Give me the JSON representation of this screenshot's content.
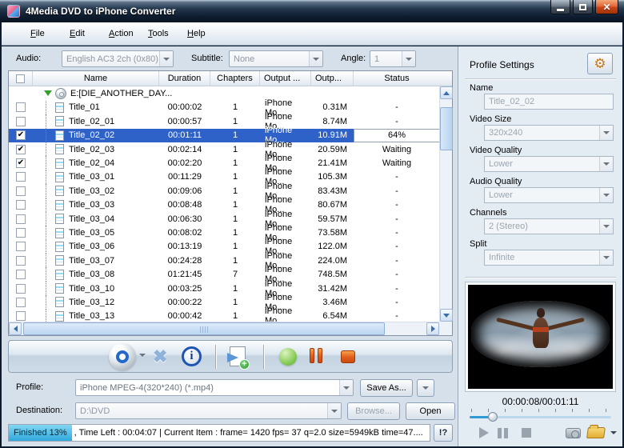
{
  "window": {
    "title": "4Media DVD to iPhone Converter"
  },
  "icons": {
    "close_glyph": "✕",
    "remove_glyph": "✖",
    "info_glyph": "i",
    "plus_glyph": "+",
    "check_glyph": "✔",
    "gear_glyph": "⚙"
  },
  "menu": {
    "items": [
      {
        "label": "File"
      },
      {
        "label": "Edit"
      },
      {
        "label": "Action"
      },
      {
        "label": "Tools"
      },
      {
        "label": "Help"
      }
    ]
  },
  "options": {
    "audio_label": "Audio:",
    "audio_value": "English AC3 2ch (0x80)",
    "subtitle_label": "Subtitle:",
    "subtitle_value": "None",
    "angle_label": "Angle:",
    "angle_value": "1"
  },
  "table": {
    "headers": {
      "name": "Name",
      "duration": "Duration",
      "chapters": "Chapters",
      "output": "Output ...",
      "output_size": "Outp...",
      "status": "Status"
    },
    "disc": {
      "name": "E:[DIE_ANOTHER_DAY..."
    },
    "rows": [
      {
        "checked": false,
        "selected": false,
        "name": "Title_01",
        "duration": "00:00:02",
        "chapters": "1",
        "output": "iPhone Mo...",
        "size": "0.31M",
        "status": "-"
      },
      {
        "checked": false,
        "selected": false,
        "name": "Title_02_01",
        "duration": "00:00:57",
        "chapters": "1",
        "output": "iPhone Mo...",
        "size": "8.74M",
        "status": "-"
      },
      {
        "checked": true,
        "selected": true,
        "name": "Title_02_02",
        "duration": "00:01:11",
        "chapters": "1",
        "output": "iPhone Mo...",
        "size": "10.91M",
        "status": "64%"
      },
      {
        "checked": true,
        "selected": false,
        "name": "Title_02_03",
        "duration": "00:02:14",
        "chapters": "1",
        "output": "iPhone Mo...",
        "size": "20.59M",
        "status": "Waiting"
      },
      {
        "checked": true,
        "selected": false,
        "name": "Title_02_04",
        "duration": "00:02:20",
        "chapters": "1",
        "output": "iPhone Mo...",
        "size": "21.41M",
        "status": "Waiting"
      },
      {
        "checked": false,
        "selected": false,
        "name": "Title_03_01",
        "duration": "00:11:29",
        "chapters": "1",
        "output": "iPhone Mo...",
        "size": "105.3M",
        "status": "-"
      },
      {
        "checked": false,
        "selected": false,
        "name": "Title_03_02",
        "duration": "00:09:06",
        "chapters": "1",
        "output": "iPhone Mo...",
        "size": "83.43M",
        "status": "-"
      },
      {
        "checked": false,
        "selected": false,
        "name": "Title_03_03",
        "duration": "00:08:48",
        "chapters": "1",
        "output": "iPhone Mo...",
        "size": "80.67M",
        "status": "-"
      },
      {
        "checked": false,
        "selected": false,
        "name": "Title_03_04",
        "duration": "00:06:30",
        "chapters": "1",
        "output": "iPhone Mo...",
        "size": "59.57M",
        "status": "-"
      },
      {
        "checked": false,
        "selected": false,
        "name": "Title_03_05",
        "duration": "00:08:02",
        "chapters": "1",
        "output": "iPhone Mo...",
        "size": "73.58M",
        "status": "-"
      },
      {
        "checked": false,
        "selected": false,
        "name": "Title_03_06",
        "duration": "00:13:19",
        "chapters": "1",
        "output": "iPhone Mo...",
        "size": "122.0M",
        "status": "-"
      },
      {
        "checked": false,
        "selected": false,
        "name": "Title_03_07",
        "duration": "00:24:28",
        "chapters": "1",
        "output": "iPhone Mo...",
        "size": "224.0M",
        "status": "-"
      },
      {
        "checked": false,
        "selected": false,
        "name": "Title_03_08",
        "duration": "01:21:45",
        "chapters": "7",
        "output": "iPhone Mo...",
        "size": "748.5M",
        "status": "-"
      },
      {
        "checked": false,
        "selected": false,
        "name": "Title_03_10",
        "duration": "00:03:25",
        "chapters": "1",
        "output": "iPhone Mo...",
        "size": "31.42M",
        "status": "-"
      },
      {
        "checked": false,
        "selected": false,
        "name": "Title_03_12",
        "duration": "00:00:22",
        "chapters": "1",
        "output": "iPhone Mo...",
        "size": "3.46M",
        "status": "-"
      },
      {
        "checked": false,
        "selected": false,
        "name": "Title_03_13",
        "duration": "00:00:42",
        "chapters": "1",
        "output": "iPhone Mo...",
        "size": "6.54M",
        "status": "-"
      }
    ]
  },
  "profile_row": {
    "label": "Profile:",
    "value": "iPhone MPEG-4(320*240)  (*.mp4)",
    "save_as_label": "Save As..."
  },
  "destination_row": {
    "label": "Destination:",
    "value": "D:\\DVD",
    "browse_label": "Browse...",
    "open_label": "Open"
  },
  "statusbar": {
    "finished_label": "Finished 13%",
    "message": ", Time Left : 00:04:07 | Current Item : frame= 1420 fps= 37 q=2.0 size=5949kB time=47....",
    "help_label": "!?"
  },
  "profile_settings": {
    "title": "Profile Settings",
    "fields": [
      {
        "label": "Name",
        "value": "Title_02_02",
        "type": "input"
      },
      {
        "label": "Video Size",
        "value": "320x240",
        "type": "select"
      },
      {
        "label": "Video Quality",
        "value": "Lower",
        "type": "select"
      },
      {
        "label": "Audio Quality",
        "value": "Lower",
        "type": "select"
      },
      {
        "label": "Channels",
        "value": "2 (Stereo)",
        "type": "select"
      },
      {
        "label": "Split",
        "value": "Infinite",
        "type": "select"
      }
    ]
  },
  "preview": {
    "time": "00:00:08/00:01:11"
  }
}
